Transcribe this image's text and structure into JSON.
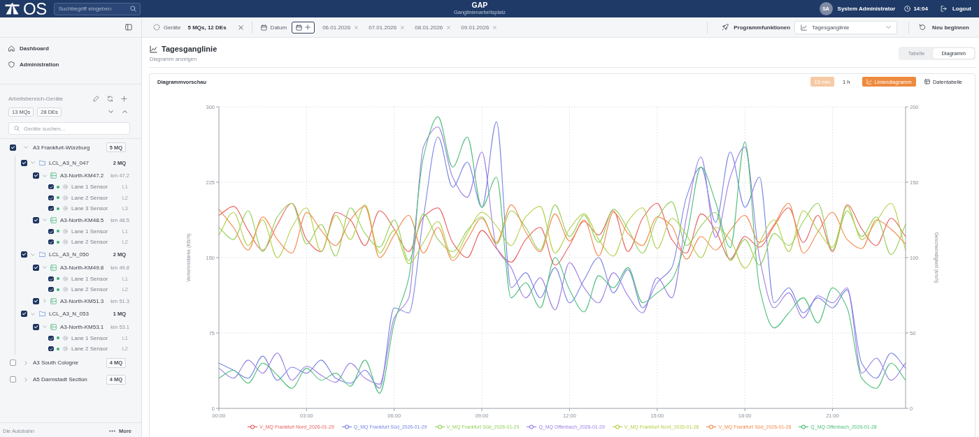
{
  "header": {
    "logo": "OS",
    "search": {
      "placeholder": "Suchbegriff eingeben"
    },
    "title": "GAP",
    "subtitle": "Ganglinienarbeitsplatz",
    "user": {
      "initials": "SA",
      "name": "System Administrator"
    },
    "time": "14:04",
    "logout": "Logout"
  },
  "sidebar": {
    "nav": [
      {
        "label": "Dashboard",
        "selected": false
      },
      {
        "label": "Administration",
        "selected": false
      }
    ],
    "workspace": {
      "title": "Arbeitsbereich-Geräte",
      "chips": [
        "13 MQs",
        "28 DEs"
      ],
      "search": {
        "placeholder": "Geräte suchen..."
      }
    },
    "tree": [
      {
        "kind": "road",
        "label": "A3 Frankfurt-Würzburg",
        "count": "5 MQ",
        "checked": true,
        "expanded": true,
        "children": [
          {
            "kind": "group",
            "label": "LCL_A3_N_047",
            "count": "2 MQ",
            "checked": true,
            "expanded": true,
            "children": [
              {
                "kind": "station",
                "label": "A3-North-KM47.2",
                "km": "km 47.2",
                "checked": true,
                "expanded": true,
                "children": [
                  {
                    "kind": "sensor",
                    "label": "Lane 1 Sensor",
                    "lane": "L1",
                    "checked": true,
                    "online": true
                  },
                  {
                    "kind": "sensor",
                    "label": "Lane 2 Sensor",
                    "lane": "L2",
                    "checked": true,
                    "online": true
                  },
                  {
                    "kind": "sensor",
                    "label": "Lane 3 Sensor",
                    "lane": "L3",
                    "checked": true,
                    "online": true
                  }
                ]
              },
              {
                "kind": "station",
                "label": "A3-North-KM48.5",
                "km": "km 48.5",
                "checked": true,
                "expanded": true,
                "children": [
                  {
                    "kind": "sensor",
                    "label": "Lane 1 Sensor",
                    "lane": "L1",
                    "checked": true,
                    "online": true
                  },
                  {
                    "kind": "sensor",
                    "label": "Lane 2 Sensor",
                    "lane": "L2",
                    "checked": true,
                    "online": true
                  }
                ]
              }
            ]
          },
          {
            "kind": "group",
            "label": "LCL_A3_N_050",
            "count": "2 MQ",
            "checked": true,
            "expanded": true,
            "children": [
              {
                "kind": "station",
                "label": "A3-North-KM49.8",
                "km": "km 49.8",
                "checked": true,
                "expanded": true,
                "children": [
                  {
                    "kind": "sensor",
                    "label": "Lane 1 Sensor",
                    "lane": "L1",
                    "checked": true,
                    "online": true
                  },
                  {
                    "kind": "sensor",
                    "label": "Lane 2 Sensor",
                    "lane": "L2",
                    "checked": true,
                    "online": true
                  }
                ]
              },
              {
                "kind": "station",
                "label": "A3-North-KM51.3",
                "km": "km 51.3",
                "checked": true,
                "expanded": false
              }
            ]
          },
          {
            "kind": "group",
            "label": "LCL_A3_N_053",
            "count": "1 MQ",
            "checked": true,
            "expanded": true,
            "children": [
              {
                "kind": "station",
                "label": "A3-North-KM53.1",
                "km": "km 53.1",
                "checked": true,
                "expanded": true,
                "children": [
                  {
                    "kind": "sensor",
                    "label": "Lane 1 Sensor",
                    "lane": "L1",
                    "checked": true,
                    "online": true
                  },
                  {
                    "kind": "sensor",
                    "label": "Lane 2 Sensor",
                    "lane": "L2",
                    "checked": true,
                    "online": true
                  }
                ]
              }
            ]
          }
        ]
      },
      {
        "kind": "road",
        "label": "A3 South Cologne",
        "count": "4 MQ",
        "checked": false,
        "expanded": false
      },
      {
        "kind": "road",
        "label": "A5 Darmstadt Section",
        "count": "4 MQ",
        "checked": false,
        "expanded": false
      }
    ],
    "footer": {
      "brand": "Die Autobahn",
      "more": "More"
    }
  },
  "toolbar": {
    "devices": {
      "label": "Geräte",
      "value": "5 MQs, 12 DEs"
    },
    "date": {
      "label": "Datum"
    },
    "dates": [
      "06.01.2026",
      "07.01.2026",
      "08.01.2026",
      "09.01.2026"
    ],
    "functions": {
      "label": "Programmfunktionen",
      "value": "Tagesganglinie"
    },
    "reset": "Neu beginnen"
  },
  "main": {
    "title": "Tagesganglinie",
    "subtitle": "Diagramm anzeigen",
    "views": [
      {
        "label": "Tabelle",
        "selected": false
      },
      {
        "label": "Diagramm",
        "selected": true
      }
    ],
    "card": {
      "title": "Diagrammvorschau",
      "intervals": [
        {
          "label": "15 min",
          "selected": true
        },
        {
          "label": "1 h",
          "selected": false
        }
      ],
      "modes": [
        {
          "label": "Liniendiagramm",
          "selected": true
        },
        {
          "label": "Datentabelle",
          "selected": false
        }
      ],
      "chart_data": {
        "type": "line",
        "ylabel": "Verkehrsstärke (Kfz/h)",
        "y2label": "Geschwindigkeit (km/h)",
        "grid": true,
        "legend": "bottom",
        "x": [
          0,
          0.5,
          1,
          1.5,
          2,
          2.5,
          3,
          3.5,
          4,
          4.5,
          5,
          5.5,
          6,
          6.5,
          7,
          7.5,
          8,
          8.5,
          9,
          9.5,
          10,
          10.5,
          11,
          11.5,
          12,
          12.5,
          13,
          13.5,
          14,
          14.5,
          15,
          15.5,
          16,
          16.5,
          17,
          17.5,
          18,
          18.5,
          19,
          19.5,
          20,
          20.5,
          21,
          21.5,
          22,
          22.5,
          23,
          23.5
        ],
        "xlim": [
          0,
          23.5
        ],
        "ylim": [
          0,
          300
        ],
        "y2lim": [
          0,
          200
        ],
        "xticks": [
          {
            "value": 0,
            "label": "00:00"
          },
          {
            "value": 3,
            "label": "03:00"
          },
          {
            "value": 6,
            "label": "06:00"
          },
          {
            "value": 9,
            "label": "09:00"
          },
          {
            "value": 12,
            "label": "12:00"
          },
          {
            "value": 15,
            "label": "15:00"
          },
          {
            "value": 18,
            "label": "18:00"
          },
          {
            "value": 21,
            "label": "21:00"
          }
        ],
        "yticks": [
          0,
          75,
          150,
          225,
          300
        ],
        "y2ticks": [
          0,
          50,
          100,
          150,
          200
        ],
        "series": [
          {
            "name": "V_MQ Frankfurt Nord_2026-01-29",
            "color": "#e8605f",
            "axis": "y2",
            "values": [
              128,
              134,
              118,
              105,
              122,
              136,
              112,
              104,
              130,
              125,
              108,
              131,
              119,
              104,
              127,
              133,
              110,
              100,
              118,
              106,
              97,
              112,
              120,
              95,
              108,
              124,
              115,
              131,
              104,
              126,
              136,
              112,
              103,
              129,
              118,
              99,
              114,
              107,
              121,
              133,
              110,
              128,
              104,
              135,
              119,
              108,
              126,
              114
            ]
          },
          {
            "name": "Q_MQ Frankfurt Süd_2026-01-29",
            "color": "#7b86e3",
            "values": [
              45,
              38,
              30,
              52,
              28,
              41,
              35,
              48,
              30,
              25,
              38,
              20,
              100,
              95,
              190,
              270,
              220,
              245,
              200,
              285,
              120,
              135,
              110,
              140,
              105,
              128,
              150,
              115,
              138,
              100,
              125,
              140,
              210,
              240,
              185,
              255,
              200,
              230,
              105,
              120,
              95,
              110,
              100,
              118,
              45,
              30,
              55,
              40
            ]
          },
          {
            "name": "V_MQ Frankfurt Süd_2026-01-29",
            "color": "#93d05a",
            "axis": "y2",
            "values": [
              120,
              112,
              131,
              104,
              127,
              136,
              109,
              122,
              101,
              133,
              116,
              107,
              125,
              98,
              129,
              112,
              104,
              118,
              127,
              109,
              131,
              120,
              105,
              135,
              114,
              128,
              110,
              132,
              119,
              103,
              126,
              137,
              108,
              121,
              130,
              98,
              112,
              95,
              116,
              108,
              124,
              136,
              105,
              131,
              114,
              127,
              102,
              122
            ]
          },
          {
            "name": "Q_MQ Offenbach_2026-01-29",
            "color": "#9d7ee4",
            "values": [
              40,
              30,
              48,
              35,
              55,
              28,
              42,
              33,
              26,
              45,
              30,
              24,
              90,
              110,
              260,
              280,
              230,
              210,
              255,
              160,
              140,
              110,
              130,
              98,
              145,
              120,
              105,
              135,
              112,
              95,
              130,
              110,
              190,
              250,
              170,
              230,
              260,
              150,
              100,
              115,
              90,
              112,
              105,
              120,
              35,
              50,
              28,
              45
            ]
          },
          {
            "name": "V_MQ Frankfurt Nord_2026-01-28",
            "color": "#b3d048",
            "axis": "y2",
            "values": [
              115,
              130,
              108,
              125,
              100,
              120,
              133,
              104,
              128,
              112,
              135,
              103,
              118,
              96,
              110,
              124,
              100,
              116,
              130,
              121,
              108,
              127,
              134,
              103,
              119,
              129,
              112,
              101,
              124,
              133,
              106,
              126,
              115,
              100,
              120,
              112,
              93,
              110,
              125,
              104,
              131,
              118,
              107,
              134,
              112,
              124,
              136,
              105
            ]
          },
          {
            "name": "V_MQ Frankfurt Süd_2026-01-28",
            "color": "#f28a4c",
            "axis": "y2",
            "values": [
              132,
              120,
              105,
              127,
              112,
              103,
              130,
              118,
              108,
              125,
              134,
              100,
              115,
              128,
              103,
              120,
              98,
              112,
              126,
              110,
              135,
              117,
              104,
              129,
              111,
              125,
              101,
              130,
              116,
              108,
              127,
              121,
              99,
              114,
              105,
              118,
              128,
              110,
              122,
              136,
              103,
              117,
              130,
              112,
              106,
              125,
              119,
              109
            ]
          },
          {
            "name": "Q_MQ Offenbach_2026-01-28",
            "color": "#4dbf7a",
            "values": [
              30,
              38,
              25,
              45,
              33,
              20,
              40,
              28,
              35,
              22,
              48,
              15,
              85,
              130,
              250,
              290,
              240,
              270,
              200,
              230,
              110,
              125,
              100,
              150,
              118,
              96,
              132,
              120,
              140,
              105,
              115,
              128,
              170,
              240,
              205,
              160,
              265,
              120,
              80,
              95,
              110,
              85,
              120,
              100,
              30,
              20,
              45,
              28
            ]
          }
        ]
      }
    }
  }
}
